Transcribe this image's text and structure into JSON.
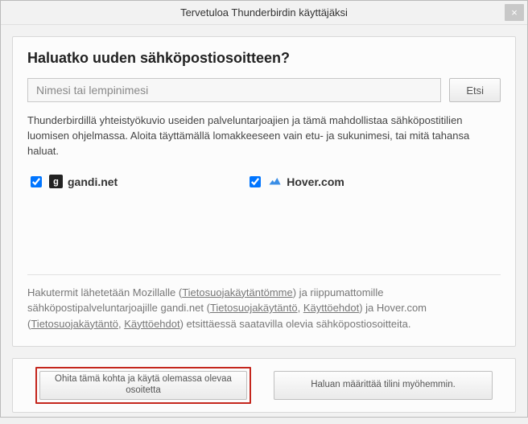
{
  "window": {
    "title": "Tervetuloa Thunderbirdin käyttäjäksi",
    "close_glyph": "×"
  },
  "main": {
    "heading": "Haluatko uuden sähköpostiosoitteen?",
    "search_placeholder": "Nimesi tai lempinimesi",
    "search_button": "Etsi",
    "description": "Thunderbirdillä yhteistyökuvio useiden palveluntarjoajien ja tämä mahdollistaa sähköpostitilien luomisen ohjelmassa. Aloita täyttämällä lomakkeeseen vain etu- ja sukunimesi, tai mitä tahansa haluat."
  },
  "providers": [
    {
      "name": "gandi.net",
      "checked": true,
      "icon": "gandi"
    },
    {
      "name": "Hover.com",
      "checked": true,
      "icon": "hover"
    }
  ],
  "footer": {
    "part1": "Hakutermit lähetetään Mozillalle (",
    "link1": "Tietosuojakäytäntömme",
    "part2": ") ja riippumattomille sähköpostipalveluntarjoajille gandi.net (",
    "link2": "Tietosuojakäytäntö",
    "sep1": ", ",
    "link3": "Käyttöehdot",
    "part3": ") ja Hover.com (",
    "link4": "Tietosuojakäytäntö",
    "sep2": ", ",
    "link5": "Käyttöehdot",
    "part4": ") etsittäessä saatavilla olevia sähköpostiosoitteita."
  },
  "buttons": {
    "skip": "Ohita tämä kohta ja käytä olemassa olevaa osoitetta",
    "later": "Haluan määrittää tilini myöhemmin."
  }
}
